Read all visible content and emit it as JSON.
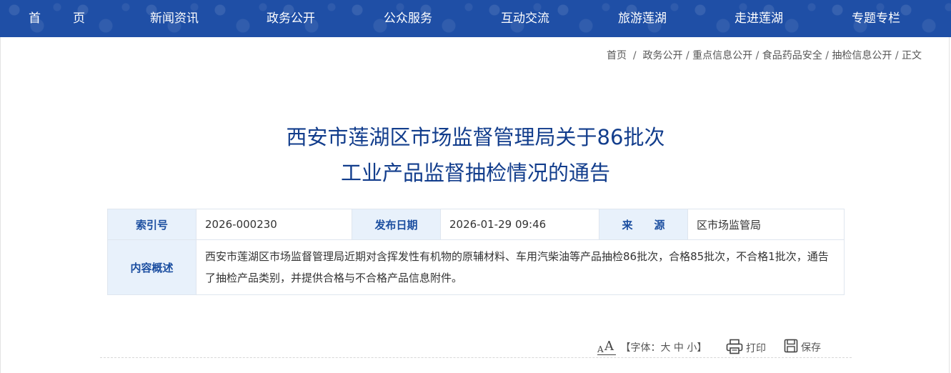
{
  "nav": {
    "home_a": "首",
    "home_b": "页",
    "items": [
      "新闻资讯",
      "政务公开",
      "公众服务",
      "互动交流",
      "旅游莲湖",
      "走进莲湖",
      "专题专栏"
    ]
  },
  "breadcrumb": {
    "items": [
      "首页",
      "政务公开",
      "重点信息公开",
      "食品药品安全",
      "抽检信息公开",
      "正文"
    ],
    "sep_first": " / ",
    "sep": " / "
  },
  "title": {
    "line1": "西安市莲湖区市场监督管理局关于86批次",
    "line2": "工业产品监督抽检情况的通告"
  },
  "info": {
    "index_label": "索引号",
    "index_value": "2026-000230",
    "date_label": "发布日期",
    "date_value": "2026-01-29 09:46",
    "source_label": "来　　源",
    "source_value": "区市场监管局",
    "summary_label": "内容概述",
    "summary_value": "西安市莲湖区市场监督管理局近期对含挥发性有机物的原辅材料、车用汽柴油等产品抽检86批次，合格85批次，不合格1批次，通告了抽检产品类别，并提供合格与不合格产品信息附件。"
  },
  "tools": {
    "fontsize_icon_small": "A",
    "fontsize_icon_big": "A",
    "fontsize_prefix": "【字体：",
    "fontsize_big": "大",
    "fontsize_mid": "中",
    "fontsize_small": "小",
    "fontsize_suffix": "】",
    "print_label": "打印",
    "save_label": "保存"
  },
  "colors": {
    "nav_bg": "#1f4fa6",
    "title": "#123d8c",
    "label_bg": "#e8f1fb",
    "label_text": "#1b4ea0"
  },
  "icons": {
    "fontsize": "font-size-icon",
    "print": "printer-icon",
    "save": "save-disk-icon"
  }
}
